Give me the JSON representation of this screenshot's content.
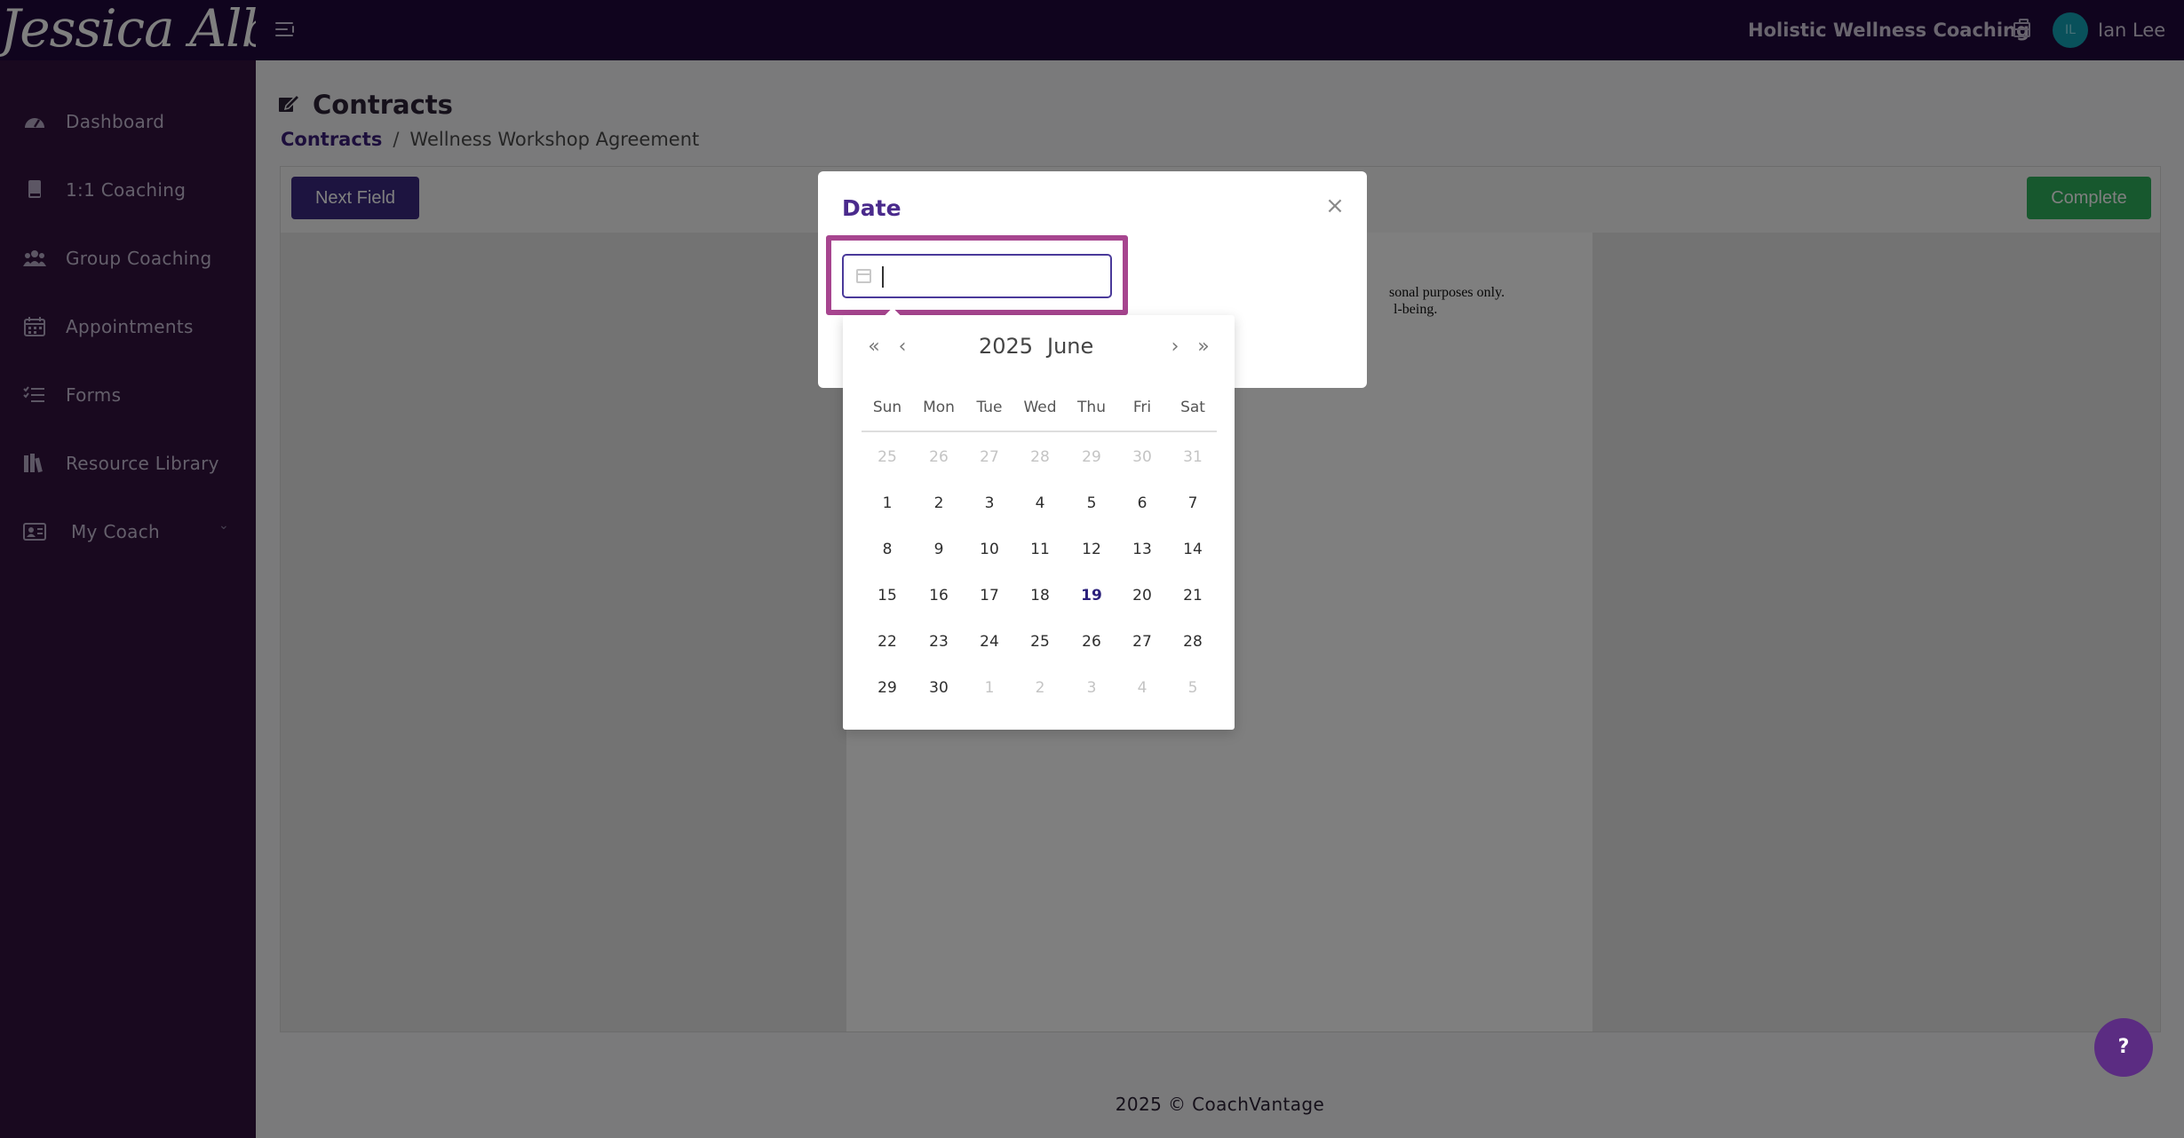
{
  "brand": {
    "name": "Jessica Albert"
  },
  "topbar": {
    "org_name": "Holistic Wellness Coaching",
    "user_initials": "IL",
    "user_name": "Ian Lee"
  },
  "sidebar": {
    "items": [
      {
        "label": "Dashboard",
        "icon": "dashboard-gauge-icon"
      },
      {
        "label": "1:1 Coaching",
        "icon": "book-icon"
      },
      {
        "label": "Group Coaching",
        "icon": "users-icon"
      },
      {
        "label": "Appointments",
        "icon": "calendar-icon"
      },
      {
        "label": "Forms",
        "icon": "checklist-icon"
      },
      {
        "label": "Resource Library",
        "icon": "library-books-icon"
      },
      {
        "label": "My Coach",
        "icon": "coach-card-icon",
        "expandable": true
      }
    ]
  },
  "page": {
    "title": "Contracts",
    "breadcrumb_link": "Contracts",
    "breadcrumb_separator": "/",
    "breadcrumb_current": "Wellness Workshop Agreement"
  },
  "toolbar": {
    "next_field_label": "Next Field",
    "complete_label": "Complete"
  },
  "document": {
    "line1": "sonal purposes only.",
    "line2": "l-being."
  },
  "modal": {
    "title": "Date",
    "close_glyph": "×",
    "input_value": "",
    "input_placeholder": ""
  },
  "datepicker": {
    "year": "2025",
    "month": "June",
    "nav_prev_year": "«",
    "nav_prev_month": "‹",
    "nav_next_month": "›",
    "nav_next_year": "»",
    "weekdays": [
      "Sun",
      "Mon",
      "Tue",
      "Wed",
      "Thu",
      "Fri",
      "Sat"
    ],
    "today": "19",
    "weeks": [
      [
        [
          "25",
          true
        ],
        [
          "26",
          true
        ],
        [
          "27",
          true
        ],
        [
          "28",
          true
        ],
        [
          "29",
          true
        ],
        [
          "30",
          true
        ],
        [
          "31",
          true
        ]
      ],
      [
        [
          "1",
          false
        ],
        [
          "2",
          false
        ],
        [
          "3",
          false
        ],
        [
          "4",
          false
        ],
        [
          "5",
          false
        ],
        [
          "6",
          false
        ],
        [
          "7",
          false
        ]
      ],
      [
        [
          "8",
          false
        ],
        [
          "9",
          false
        ],
        [
          "10",
          false
        ],
        [
          "11",
          false
        ],
        [
          "12",
          false
        ],
        [
          "13",
          false
        ],
        [
          "14",
          false
        ]
      ],
      [
        [
          "15",
          false
        ],
        [
          "16",
          false
        ],
        [
          "17",
          false
        ],
        [
          "18",
          false
        ],
        [
          "19",
          false
        ],
        [
          "20",
          false
        ],
        [
          "21",
          false
        ]
      ],
      [
        [
          "22",
          false
        ],
        [
          "23",
          false
        ],
        [
          "24",
          false
        ],
        [
          "25",
          false
        ],
        [
          "26",
          false
        ],
        [
          "27",
          false
        ],
        [
          "28",
          false
        ]
      ],
      [
        [
          "29",
          false
        ],
        [
          "30",
          false
        ],
        [
          "1",
          true
        ],
        [
          "2",
          true
        ],
        [
          "3",
          true
        ],
        [
          "4",
          true
        ],
        [
          "5",
          true
        ]
      ]
    ]
  },
  "footer": {
    "text": "2025 © CoachVantage"
  },
  "help": {
    "label": "?"
  },
  "colors": {
    "topbar_bg": "#21093d",
    "sidebar_bg": "#32123f",
    "primary_button": "#3b2880",
    "complete_button": "#2fb15c",
    "focus_ring": "#a7458f",
    "avatar_bg": "#13a2b7",
    "help_button": "#5b2c82"
  }
}
